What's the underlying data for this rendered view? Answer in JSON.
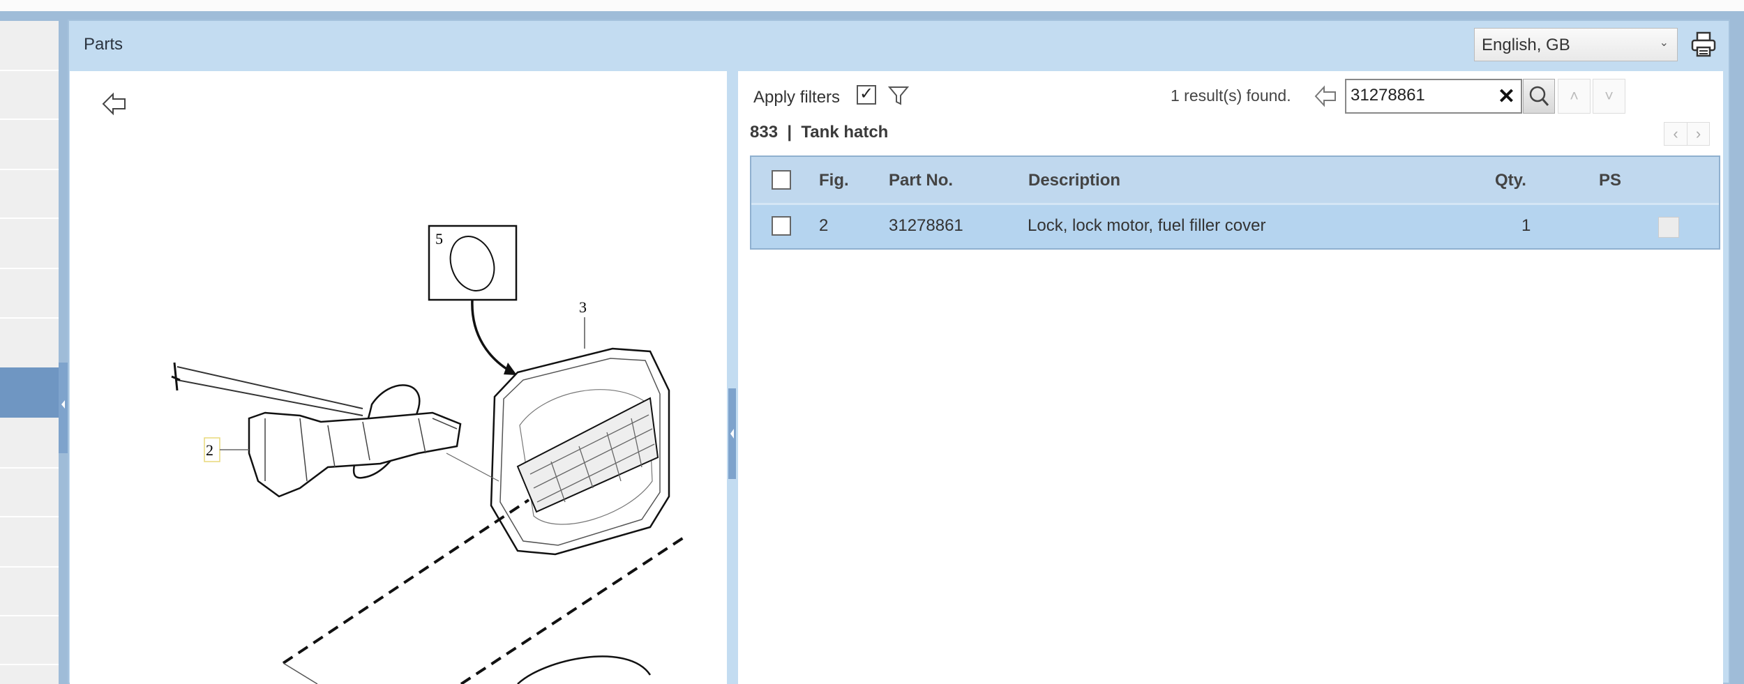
{
  "header": {
    "title": "Parts",
    "language": "English, GB"
  },
  "filters": {
    "label": "Apply filters",
    "checked": true
  },
  "search": {
    "results_text": "1 result(s) found.",
    "value": "31278861",
    "clear": "✕"
  },
  "section": {
    "title": "833  |  Tank hatch"
  },
  "table": {
    "columns": [
      "Fig.",
      "Part No.",
      "Description",
      "Qty.",
      "PS"
    ],
    "rows": [
      {
        "fig": "2",
        "part_no": "31278861",
        "description": "Lock, lock motor, fuel filler cover",
        "qty": "1"
      }
    ]
  },
  "drawing": {
    "callouts": [
      "5",
      "3",
      "2"
    ]
  },
  "icons": {
    "up": "˄",
    "down": "˅",
    "prev": "‹",
    "next": "›",
    "chev": "⌄"
  }
}
